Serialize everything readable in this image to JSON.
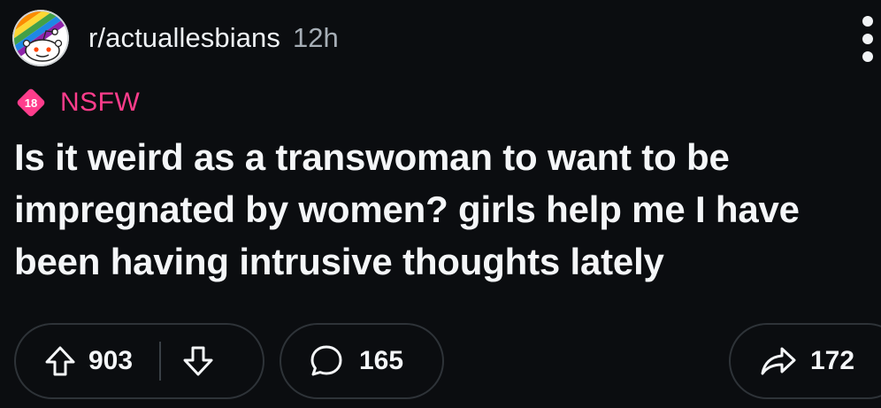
{
  "post": {
    "subreddit": "r/actuallesbians",
    "time": "12h",
    "nsfw_badge": "18",
    "nsfw_label": "NSFW",
    "title": "Is it weird as a transwoman to want to be impregnated by women? girls help me I have been having intrusive thoughts lately"
  },
  "actions": {
    "upvotes": "903",
    "comments": "165",
    "shares": "172"
  },
  "icons": {
    "avatar": "subreddit-avatar-rainbow-snoo",
    "more": "more-vertical-icon",
    "nsfw": "nsfw-diamond-icon",
    "upvote": "upvote-arrow-icon",
    "downvote": "downvote-arrow-icon",
    "comment": "comment-bubble-icon",
    "share": "share-arrow-icon"
  },
  "colors": {
    "background": "#0b0d10",
    "nsfw": "#ff3d8c",
    "text": "#f4f6f8",
    "muted": "#a6aeb6",
    "pill_border": "#2e3338"
  }
}
